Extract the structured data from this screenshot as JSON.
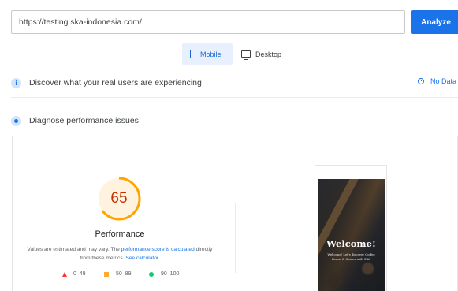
{
  "search": {
    "url_value": "https://testing.ska-indonesia.com/",
    "analyze_label": "Analyze"
  },
  "device_tabs": {
    "mobile_label": "Mobile",
    "desktop_label": "Desktop",
    "selected": "Mobile"
  },
  "field_data": {
    "icon_glyph": "i",
    "heading": "Discover what your real users are experiencing",
    "status": "No Data"
  },
  "lab_data": {
    "heading": "Diagnose performance issues"
  },
  "performance": {
    "score": "65",
    "score_fraction": 0.65,
    "score_color": "#c33300",
    "ring_color": "#ffa400",
    "ring_track_color": "#fff3e0",
    "label": "Performance",
    "note_prefix": "Values are estimated and may vary. The ",
    "note_link1": "performance score is calculated",
    "note_mid": " directly from these metrics. ",
    "note_link2": "See calculator.",
    "legend": {
      "fail": "0–49",
      "average": "50–89",
      "pass": "90–100"
    },
    "legend_colors": {
      "fail": "#ff3333",
      "average": "#ffaa33",
      "pass": "#0cce6b"
    }
  },
  "screenshot": {
    "title": "Welcome!",
    "subtitle": "Welcome! Let's discover Coffee Beans & Spices with SKA"
  },
  "colors": {
    "accent": "#1a73e8",
    "tab_selected_bg": "#e8f0fe"
  }
}
